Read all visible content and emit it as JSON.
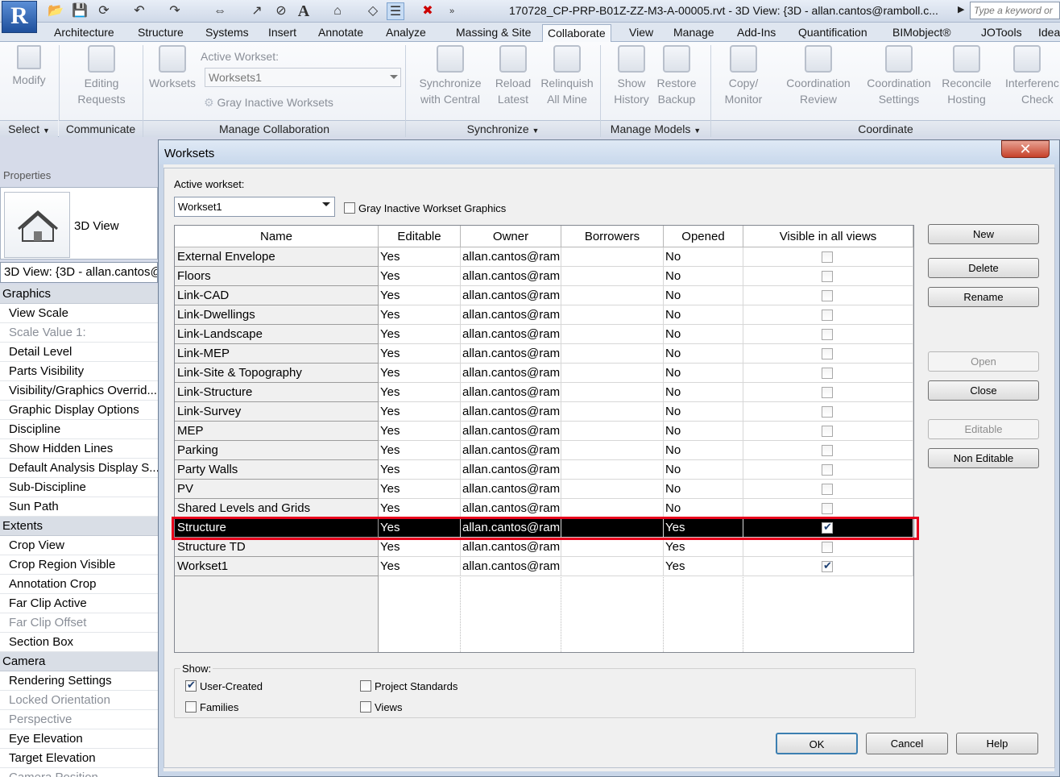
{
  "app": {
    "logo_letter": "R",
    "title": "170728_CP-PRP-B01Z-ZZ-M3-A-00005.rvt - 3D View: {3D - allan.cantos@ramboll.c...",
    "search_placeholder": "Type a keyword or"
  },
  "ribbon_tabs": [
    "Architecture",
    "Structure",
    "Systems",
    "Insert",
    "Annotate",
    "Analyze",
    "Massing & Site",
    "Collaborate",
    "View",
    "Manage",
    "Add-Ins",
    "Quantification",
    "BIMobject®",
    "JOTools",
    "Idea"
  ],
  "active_tab": "Collaborate",
  "ribbon": {
    "modify": "Modify",
    "editing_requests": [
      "Editing",
      "Requests"
    ],
    "worksets": "Worksets",
    "active_workset_label": "Active Workset:",
    "active_workset_value": "Worksets1",
    "gray_inactive": "Gray Inactive Worksets",
    "sync_central": [
      "Synchronize",
      "with Central"
    ],
    "reload_latest": [
      "Reload",
      "Latest"
    ],
    "relinquish": [
      "Relinquish",
      "All Mine"
    ],
    "show_history": [
      "Show",
      "History"
    ],
    "restore_backup": [
      "Restore",
      "Backup"
    ],
    "copy_monitor": [
      "Copy/",
      "Monitor"
    ],
    "coord_review": [
      "Coordination",
      "Review"
    ],
    "coord_settings": [
      "Coordination",
      "Settings"
    ],
    "reconcile": [
      "Reconcile",
      "Hosting"
    ],
    "interference": [
      "Interferenc",
      "Check"
    ],
    "panels": {
      "select": "Select",
      "communicate": "Communicate",
      "manage_collab": "Manage Collaboration",
      "synchronize": "Synchronize",
      "manage_models": "Manage Models",
      "coordinate": "Coordinate"
    }
  },
  "properties": {
    "title": "Properties",
    "type_label": "3D View",
    "selector": "3D View: {3D - allan.cantos@",
    "rows": [
      {
        "kind": "cat",
        "text": "Graphics"
      },
      {
        "kind": "row",
        "text": "View Scale"
      },
      {
        "kind": "dis",
        "text": "Scale Value    1:"
      },
      {
        "kind": "row",
        "text": "Detail Level"
      },
      {
        "kind": "row",
        "text": "Parts Visibility"
      },
      {
        "kind": "row",
        "text": "Visibility/Graphics Overrid..."
      },
      {
        "kind": "row",
        "text": "Graphic Display Options"
      },
      {
        "kind": "row",
        "text": "Discipline"
      },
      {
        "kind": "row",
        "text": "Show Hidden Lines"
      },
      {
        "kind": "row",
        "text": "Default Analysis Display S..."
      },
      {
        "kind": "row",
        "text": "Sub-Discipline"
      },
      {
        "kind": "row",
        "text": "Sun Path"
      },
      {
        "kind": "cat",
        "text": "Extents"
      },
      {
        "kind": "row",
        "text": "Crop View"
      },
      {
        "kind": "row",
        "text": "Crop Region Visible"
      },
      {
        "kind": "row",
        "text": "Annotation Crop"
      },
      {
        "kind": "row",
        "text": "Far Clip Active"
      },
      {
        "kind": "dis",
        "text": "Far Clip Offset"
      },
      {
        "kind": "row",
        "text": "Section Box"
      },
      {
        "kind": "cat",
        "text": "Camera"
      },
      {
        "kind": "row",
        "text": "Rendering Settings"
      },
      {
        "kind": "dis",
        "text": "Locked Orientation"
      },
      {
        "kind": "dis",
        "text": "Perspective"
      },
      {
        "kind": "row",
        "text": "Eye Elevation"
      },
      {
        "kind": "row",
        "text": "Target Elevation"
      },
      {
        "kind": "dis",
        "text": "Camera Position"
      }
    ]
  },
  "dialog": {
    "title": "Worksets",
    "close_glyph": "✕",
    "active_workset_label": "Active workset:",
    "active_workset_value": "Workset1",
    "gray_inactive_label": "Gray Inactive Workset Graphics",
    "columns": [
      "Name",
      "Editable",
      "Owner",
      "Borrowers",
      "Opened",
      "Visible in all views"
    ],
    "rows": [
      {
        "name": "External Envelope",
        "editable": "Yes",
        "owner": "allan.cantos@ram",
        "borrowers": "",
        "opened": "No",
        "visible": false
      },
      {
        "name": "Floors",
        "editable": "Yes",
        "owner": "allan.cantos@ram",
        "borrowers": "",
        "opened": "No",
        "visible": false
      },
      {
        "name": "Link-CAD",
        "editable": "Yes",
        "owner": "allan.cantos@ram",
        "borrowers": "",
        "opened": "No",
        "visible": false
      },
      {
        "name": "Link-Dwellings",
        "editable": "Yes",
        "owner": "allan.cantos@ram",
        "borrowers": "",
        "opened": "No",
        "visible": false
      },
      {
        "name": "Link-Landscape",
        "editable": "Yes",
        "owner": "allan.cantos@ram",
        "borrowers": "",
        "opened": "No",
        "visible": false
      },
      {
        "name": "Link-MEP",
        "editable": "Yes",
        "owner": "allan.cantos@ram",
        "borrowers": "",
        "opened": "No",
        "visible": false
      },
      {
        "name": "Link-Site & Topography",
        "editable": "Yes",
        "owner": "allan.cantos@ram",
        "borrowers": "",
        "opened": "No",
        "visible": false
      },
      {
        "name": "Link-Structure",
        "editable": "Yes",
        "owner": "allan.cantos@ram",
        "borrowers": "",
        "opened": "No",
        "visible": false
      },
      {
        "name": "Link-Survey",
        "editable": "Yes",
        "owner": "allan.cantos@ram",
        "borrowers": "",
        "opened": "No",
        "visible": false
      },
      {
        "name": "MEP",
        "editable": "Yes",
        "owner": "allan.cantos@ram",
        "borrowers": "",
        "opened": "No",
        "visible": false
      },
      {
        "name": "Parking",
        "editable": "Yes",
        "owner": "allan.cantos@ram",
        "borrowers": "",
        "opened": "No",
        "visible": false
      },
      {
        "name": "Party Walls",
        "editable": "Yes",
        "owner": "allan.cantos@ram",
        "borrowers": "",
        "opened": "No",
        "visible": false
      },
      {
        "name": "PV",
        "editable": "Yes",
        "owner": "allan.cantos@ram",
        "borrowers": "",
        "opened": "No",
        "visible": false
      },
      {
        "name": "Shared Levels and Grids",
        "editable": "Yes",
        "owner": "allan.cantos@ram",
        "borrowers": "",
        "opened": "No",
        "visible": false
      },
      {
        "name": "Structure",
        "editable": "Yes",
        "owner": "allan.cantos@ram",
        "borrowers": "",
        "opened": "Yes",
        "visible": true,
        "selected": true
      },
      {
        "name": "Structure TD",
        "editable": "Yes",
        "owner": "allan.cantos@ram",
        "borrowers": "",
        "opened": "Yes",
        "visible": false
      },
      {
        "name": "Workset1",
        "editable": "Yes",
        "owner": "allan.cantos@ram",
        "borrowers": "",
        "opened": "Yes",
        "visible": true
      }
    ],
    "side_buttons": {
      "new": "New",
      "delete": "Delete",
      "rename": "Rename",
      "open": "Open",
      "close": "Close",
      "editable": "Editable",
      "non_editable": "Non Editable"
    },
    "show": {
      "label": "Show:",
      "user_created": "User-Created",
      "families": "Families",
      "project_standards": "Project Standards",
      "views": "Views",
      "user_created_checked": true
    },
    "ok": "OK",
    "cancel": "Cancel",
    "help": "Help"
  },
  "colors": {
    "selection_outline": "#e8001c",
    "selected_row_bg": "#000000",
    "logo_blue": "#1e4f9c"
  }
}
